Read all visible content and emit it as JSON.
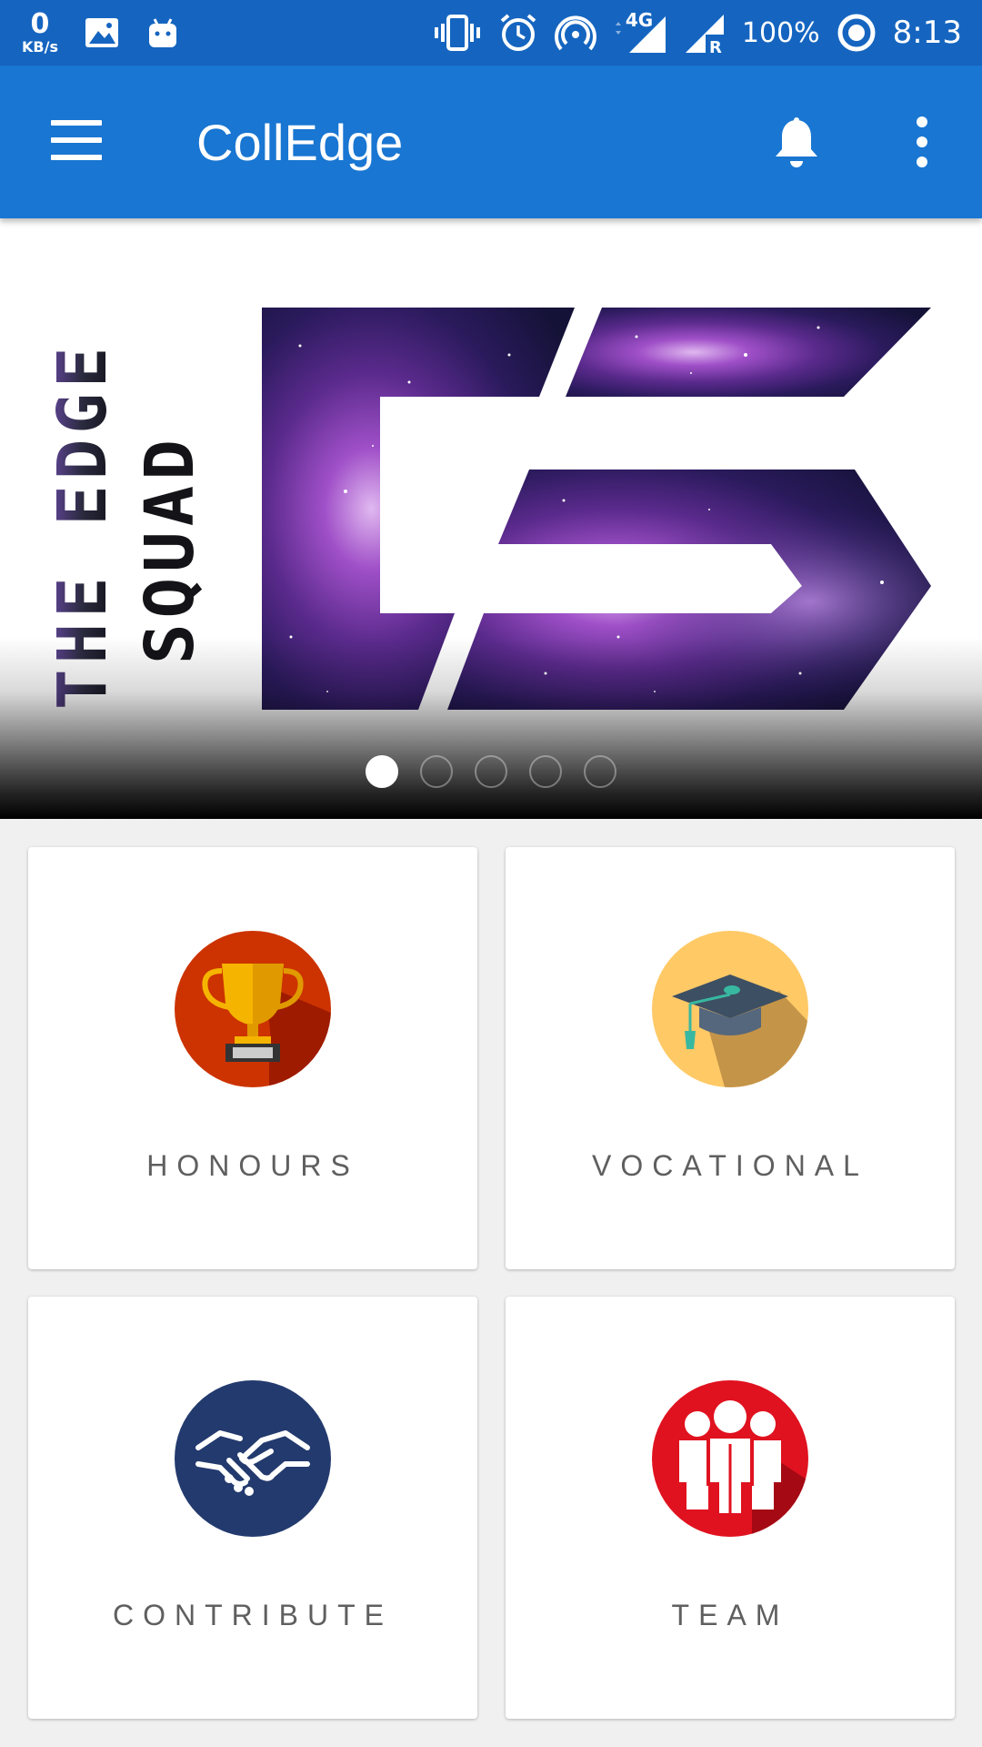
{
  "status_bar": {
    "speed_value": "0",
    "speed_unit": "KB/s",
    "network": "4G",
    "battery": "100%",
    "time": "8:13",
    "icons": [
      "image-icon",
      "android-icon",
      "vibrate-icon",
      "alarm-icon",
      "hotspot-icon",
      "signal-icon",
      "roaming-signal-icon",
      "battery-saver-icon"
    ]
  },
  "app_bar": {
    "title": "CollEdge",
    "color": "#1976d2"
  },
  "banner": {
    "logo_line1": "THE EDGE",
    "logo_line2": "SQUAD",
    "slide_count": 5,
    "active_slide": 1
  },
  "tiles": [
    {
      "label": "HONOURS",
      "icon": "trophy-icon",
      "color": "#cc3300"
    },
    {
      "label": "VOCATIONAL",
      "icon": "graduation-cap-icon",
      "color": "#ffc966"
    },
    {
      "label": "CONTRIBUTE",
      "icon": "handshake-icon",
      "color": "#233a6e"
    },
    {
      "label": "TEAM",
      "icon": "team-icon",
      "color": "#e0121f"
    }
  ]
}
